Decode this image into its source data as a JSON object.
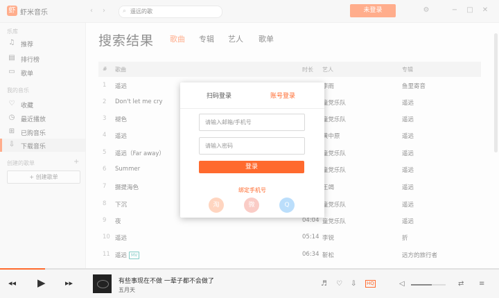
{
  "app": {
    "brand": "虾米音乐",
    "logo_char": "虾"
  },
  "search": {
    "value": "遥远的歌"
  },
  "header": {
    "login_button": "未登录"
  },
  "sidebar": {
    "library_title": "乐库",
    "library": [
      {
        "icon": "music-note-icon",
        "glyph": "♫",
        "label": "推荐"
      },
      {
        "icon": "chart-icon",
        "glyph": "▤",
        "label": "排行榜"
      },
      {
        "icon": "monitor-icon",
        "glyph": "▭",
        "label": "歌单"
      }
    ],
    "mymusic_title": "我的音乐",
    "mymusic": [
      {
        "icon": "heart-icon",
        "glyph": "♡",
        "label": "收藏"
      },
      {
        "icon": "clock-icon",
        "glyph": "◷",
        "label": "最近播放"
      },
      {
        "icon": "cart-icon",
        "glyph": "⊞",
        "label": "已购音乐"
      },
      {
        "icon": "download-icon",
        "glyph": "⇩",
        "label": "下载音乐"
      }
    ],
    "created_title": "创建的歌单",
    "new_playlist": "+ 创建歌单"
  },
  "main": {
    "title": "搜索结果",
    "tabs": [
      "歌曲",
      "专辑",
      "艺人",
      "歌单"
    ],
    "columns": {
      "num": "#",
      "song": "歌曲",
      "time": "时长",
      "artist": "艺人",
      "album": "专辑"
    },
    "rows": [
      {
        "num": "1",
        "song": "遥远",
        "badge": "",
        "time": "",
        "artist": "李雨",
        "album": "鱼里寄音"
      },
      {
        "num": "2",
        "song": "Don't let me cry",
        "badge": "",
        "time": "",
        "artist": "童党乐队",
        "album": "遥远"
      },
      {
        "num": "3",
        "song": "褪色",
        "badge": "",
        "time": "",
        "artist": "童党乐队",
        "album": "遥远"
      },
      {
        "num": "4",
        "song": "遥远",
        "badge": "",
        "time": "",
        "artist": "黄中原",
        "album": "遥远"
      },
      {
        "num": "5",
        "song": "遥远（Far away）",
        "badge": "",
        "time": "",
        "artist": "童党乐队",
        "album": "遥远"
      },
      {
        "num": "6",
        "song": "Summer",
        "badge": "",
        "time": "",
        "artist": "童党乐队",
        "album": "遥远"
      },
      {
        "num": "7",
        "song": "摄提海色",
        "badge": "",
        "time": "",
        "artist": "王竭",
        "album": "遥远"
      },
      {
        "num": "8",
        "song": "下沉",
        "badge": "",
        "time": "",
        "artist": "童党乐队",
        "album": "遥远"
      },
      {
        "num": "9",
        "song": "夜",
        "badge": "",
        "time": "04:04",
        "artist": "童党乐队",
        "album": "遥远"
      },
      {
        "num": "10",
        "song": "遥远",
        "badge": "",
        "time": "05:14",
        "artist": "李锐",
        "album": "折"
      },
      {
        "num": "11",
        "song": "遥远",
        "badge": "MV",
        "time": "06:34",
        "artist": "靳松",
        "album": "远方的旅行者"
      }
    ]
  },
  "modal": {
    "tab_qr": "扫码登录",
    "tab_account": "账号登录",
    "email_placeholder": "请输入邮箱/手机号",
    "password_placeholder": "请输入密码",
    "submit": "登录",
    "bind_phone": "绑定手机号",
    "social": [
      {
        "icon": "taobao-icon",
        "glyph": "淘",
        "color": "#ff8a4c"
      },
      {
        "icon": "weibo-icon",
        "glyph": "微",
        "color": "#f2705e"
      },
      {
        "icon": "qq-icon",
        "glyph": "Q",
        "color": "#3ea2f5"
      }
    ]
  },
  "player": {
    "song": "有些事现在不做 一辈子都不会做了",
    "artist": "五月天",
    "quality": "HQ",
    "progress": 0.09,
    "volume": 0.6
  },
  "colors": {
    "accent": "#ff6a2e"
  }
}
